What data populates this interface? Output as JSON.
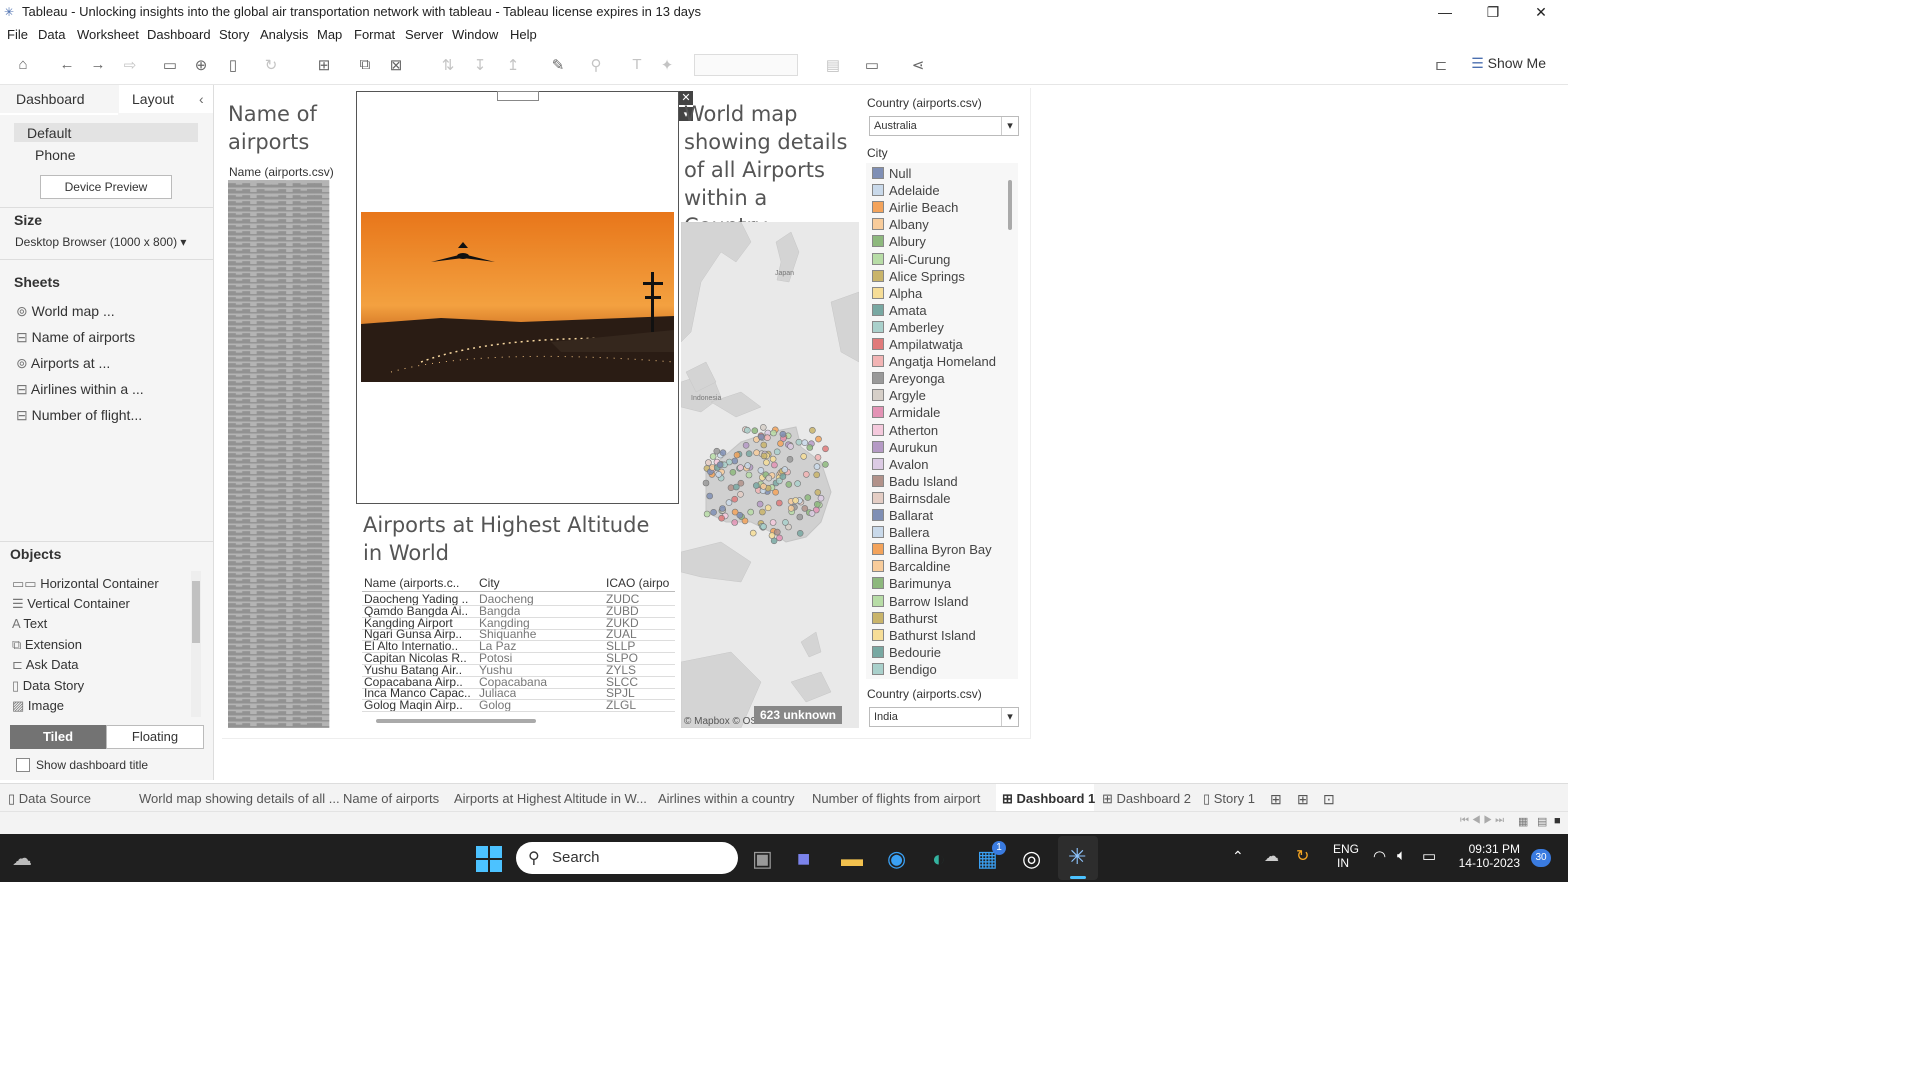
{
  "window": {
    "title": "Tableau - Unlocking insights into the global air transportation network with tableau - Tableau license expires in 13 days",
    "minimize": "—",
    "restore": "❐",
    "close": "✕"
  },
  "menu": [
    "File",
    "Data",
    "Worksheet",
    "Dashboard",
    "Story",
    "Analysis",
    "Map",
    "Format",
    "Server",
    "Window",
    "Help"
  ],
  "toolbar": {
    "show_me": "Show Me"
  },
  "left_panel": {
    "tabs": [
      "Dashboard",
      "Layout"
    ],
    "collapse": "‹",
    "devices": [
      "Default",
      "Phone"
    ],
    "device_preview": "Device Preview",
    "size_head": "Size",
    "size_value": "Desktop Browser (1000 x 800)",
    "sheets_head": "Sheets",
    "sheets": [
      "World map ...",
      "Name of airports",
      "Airports at ...",
      "Airlines within a ...",
      "Number of flight..."
    ],
    "objects_head": "Objects",
    "objects": [
      "Horizontal Container",
      "Vertical Container",
      "Text",
      "Extension",
      "Ask Data",
      "Data Story",
      "Image"
    ],
    "tiled": "Tiled",
    "floating": "Floating",
    "show_title": "Show dashboard title"
  },
  "dashboard": {
    "names_title": "Name of airports",
    "names_header": "Name (airports.csv)",
    "map_title": "World map showing details of all Airports within a Country",
    "map_labels": {
      "japan": "Japan",
      "indonesia": "Indonesia"
    },
    "map_attrib": "© Mapbox © OSM",
    "unknown": "623 unknown",
    "alt_title": "Airports at Highest Altitude in World",
    "alt_headers": [
      "Name (airports.c..",
      "City",
      "ICAO (airpo"
    ],
    "alt_rows": [
      [
        "Daocheng Yading ..",
        "Daocheng",
        "ZUDC"
      ],
      [
        "Qamdo Bangda Ai..",
        "Bangda",
        "ZUBD"
      ],
      [
        "Kangding Airport",
        "Kangding",
        "ZUKD"
      ],
      [
        "Ngari Gunsa Airp..",
        "Shiquanhe",
        "ZUAL"
      ],
      [
        "El Alto Internatio..",
        "La Paz",
        "SLLP"
      ],
      [
        "Capitan Nicolas R..",
        "Potosi",
        "SLPO"
      ],
      [
        "Yushu Batang Air..",
        "Yushu",
        "ZYLS"
      ],
      [
        "Copacabana Airp..",
        "Copacabana",
        "SLCC"
      ],
      [
        "Inca Manco Capac..",
        "Juliaca",
        "SPJL"
      ],
      [
        "Golog Maqin Airp..",
        "Golog",
        "ZLGL"
      ]
    ]
  },
  "filters": {
    "country_label": "Country (airports.csv)",
    "country_value": "Australia",
    "city_label": "City",
    "cities": [
      {
        "name": "Null",
        "color": "#7f8fb5"
      },
      {
        "name": "Adelaide",
        "color": "#c9d9ea"
      },
      {
        "name": "Airlie Beach",
        "color": "#f3a35b"
      },
      {
        "name": "Albany",
        "color": "#f8cc9b"
      },
      {
        "name": "Albury",
        "color": "#8db87d"
      },
      {
        "name": "Ali-Curung",
        "color": "#b7dca6"
      },
      {
        "name": "Alice Springs",
        "color": "#c9b46a"
      },
      {
        "name": "Alpha",
        "color": "#f6dd97"
      },
      {
        "name": "Amata",
        "color": "#78a8a2"
      },
      {
        "name": "Amberley",
        "color": "#a9d0cb"
      },
      {
        "name": "Ampilatwatja",
        "color": "#e07a7a"
      },
      {
        "name": "Angatja Homeland",
        "color": "#f2b4b4"
      },
      {
        "name": "Areyonga",
        "color": "#999999"
      },
      {
        "name": "Argyle",
        "color": "#d6cfc8"
      },
      {
        "name": "Armidale",
        "color": "#e393b5"
      },
      {
        "name": "Atherton",
        "color": "#f4c9dc"
      },
      {
        "name": "Aurukun",
        "color": "#b59ac5"
      },
      {
        "name": "Avalon",
        "color": "#dccbe4"
      },
      {
        "name": "Badu Island",
        "color": "#b2928a"
      },
      {
        "name": "Bairnsdale",
        "color": "#e4cdc4"
      },
      {
        "name": "Ballarat",
        "color": "#7f8fb5"
      },
      {
        "name": "Ballera",
        "color": "#c9d9ea"
      },
      {
        "name": "Ballina Byron Bay",
        "color": "#f3a35b"
      },
      {
        "name": "Barcaldine",
        "color": "#f8cc9b"
      },
      {
        "name": "Barimunya",
        "color": "#8db87d"
      },
      {
        "name": "Barrow Island",
        "color": "#b7dca6"
      },
      {
        "name": "Bathurst",
        "color": "#c9b46a"
      },
      {
        "name": "Bathurst Island",
        "color": "#f6dd97"
      },
      {
        "name": "Bedourie",
        "color": "#78a8a2"
      },
      {
        "name": "Bendigo",
        "color": "#a9d0cb"
      }
    ],
    "country2_label": "Country (airports.csv)",
    "country2_value": "India"
  },
  "sheet_tabs": [
    "Data Source",
    "World map showing details of all ...",
    "Name of airports",
    "Airports at Highest Altitude in W...",
    "Airlines within a country",
    "Number of flights from airport",
    "Dashboard 1",
    "Dashboard 2",
    "Story 1"
  ],
  "taskbar": {
    "search": "Search",
    "lang": "ENG",
    "region": "IN",
    "time": "09:31 PM",
    "date": "14-10-2023",
    "badge": "1",
    "notif": "30"
  }
}
